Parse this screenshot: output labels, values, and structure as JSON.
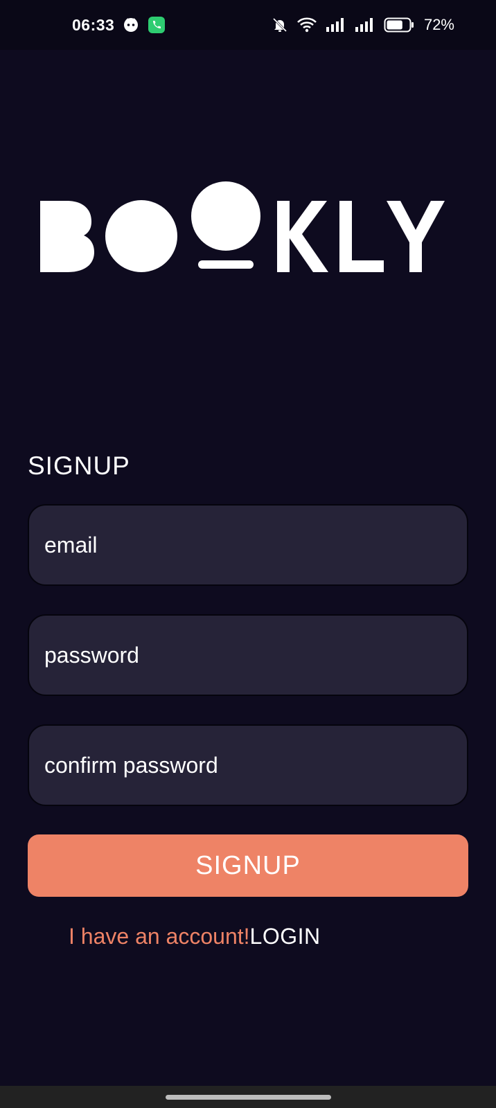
{
  "status_bar": {
    "time": "06:33",
    "battery_percent": "72%",
    "battery_level": 0.72,
    "icons": [
      "assistant-face-icon",
      "phone-call-icon",
      "bell-muted-icon",
      "wifi-icon",
      "signal-icon",
      "signal-icon",
      "battery-icon"
    ],
    "call_icon_color": "#2ecc71"
  },
  "logo": {
    "text": "BOOKLY"
  },
  "form": {
    "title": "SIGNUP",
    "email_placeholder": "email",
    "password_placeholder": "password",
    "confirm_placeholder": "confirm password",
    "submit_label": "SIGNUP"
  },
  "login": {
    "prompt": "I have an account!",
    "link_label": "LOGIN"
  },
  "colors": {
    "background": "#0e0b1f",
    "field_background": "#262338",
    "accent": "#ee8366"
  }
}
